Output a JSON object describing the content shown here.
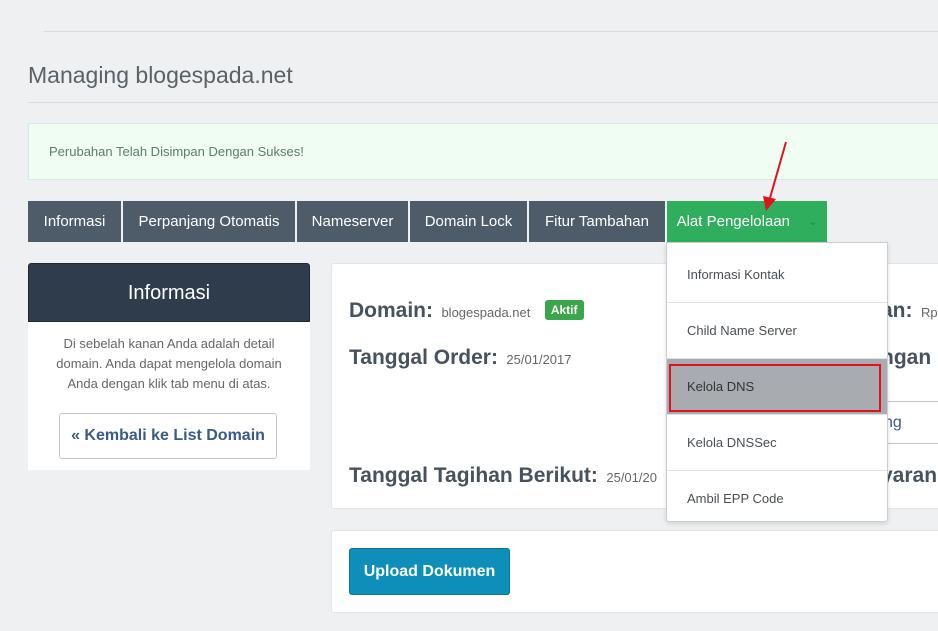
{
  "page": {
    "title": "Managing blogespada.net"
  },
  "alert": {
    "message": "Perubahan Telah Disimpan Dengan Sukses!"
  },
  "tabs": [
    {
      "label": "Informasi"
    },
    {
      "label": "Perpanjang Otomatis"
    },
    {
      "label": "Nameserver"
    },
    {
      "label": "Domain Lock"
    },
    {
      "label": "Fitur Tambahan"
    },
    {
      "label": "Alat Pengelolaan",
      "active": true,
      "icon": "chevron-down-icon"
    }
  ],
  "sidebar": {
    "title": "Informasi",
    "description": "Di sebelah kanan Anda adalah detail domain. Anda dapat mengelola domain Anda dengan klik tab menu di atas.",
    "back_button": "« Kembali ke List Domain"
  },
  "details": {
    "domain_label": "Domain:",
    "domain_value": "blogespada.net",
    "status_badge": "Aktif",
    "order_label": "Tanggal Order:",
    "order_value": "25/01/2017",
    "next_invoice_label": "Tanggal Tagihan Berikut:",
    "next_invoice_value": "25/01/20",
    "right_label_1": "an:",
    "right_value_1": "Rp",
    "right_label_2": "ngan",
    "right_button": "ng",
    "right_label_3": "yaran"
  },
  "upload": {
    "button": "Upload Dokumen"
  },
  "dropdown": {
    "items": [
      {
        "label": "Informasi Kontak"
      },
      {
        "label": "Child Name Server"
      },
      {
        "label": "Kelola DNS",
        "highlighted": true
      },
      {
        "label": "Kelola DNSSec"
      },
      {
        "label": "Ambil EPP Code"
      }
    ]
  },
  "colors": {
    "tab_bg": "#4e5c69",
    "tab_active_bg": "#2fae5d",
    "annotation_red": "#e0121c",
    "upload_button": "#0e8fb9"
  }
}
